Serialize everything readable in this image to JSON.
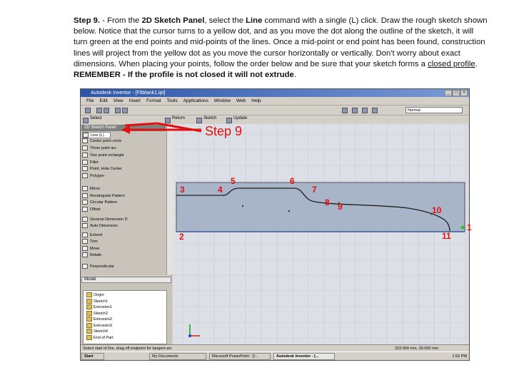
{
  "instructions": {
    "step": "Step 9.",
    "dash": " - From the ",
    "panel": "2D Sketch Panel",
    "p1": ", select the ",
    "cmd": "Line",
    "p2": " command with a single (L) click. Draw the rough sketch shown below. Notice that the cursor turns to a yellow dot, and as you move the dot along the outline of the sketch, it will turn green at the end points and mid-points of the lines. Once a  mid-point or end point has been found, construction lines will project from the yellow dot as you move the cursor horizontally or vertically. Don't worry about exact dimensions. When placing your points, follow the order below and be sure that your sketch forms a ",
    "closed": "closed profile",
    "p3": ". ",
    "remember": "REMEMBER - If the profile is not closed it will not extrude",
    "p4": "."
  },
  "window": {
    "title": "Autodesk Inventor - [Fltblank1.ipt]",
    "menu": [
      "File",
      "Edit",
      "View",
      "Insert",
      "Format",
      "Tools",
      "Applications",
      "Window",
      "Web",
      "Help"
    ],
    "toolbar_labels": [
      "Select",
      "Return",
      "Sketch",
      "Update"
    ],
    "style_combo": "Normal"
  },
  "sketch_panel": {
    "title": "2D Sketch Panel",
    "items": [
      "Line  (L)",
      "Center point circle",
      "Three point arc",
      "Two point rectangle",
      "Fillet",
      "Point, Hole Center",
      "Polygon",
      "Mirror",
      "Rectangular Pattern",
      "Circular Pattern",
      "Offset",
      "General Dimension   D",
      "Auto Dimension",
      "Extend",
      "Trim",
      "Move",
      "Rotate",
      "Perpendicular"
    ]
  },
  "browser": {
    "header": "Model",
    "items": [
      "Origin",
      "Sketch1",
      "Extrusion1",
      "Sketch2",
      "Extrusion2",
      "Extrusion3",
      "Sketch4",
      "End of Part"
    ]
  },
  "status": {
    "left": "Select start of line, drag off endpoint for tangent arc",
    "right": "223.000 mm, 39.000 mm"
  },
  "taskbar": {
    "start": "Start",
    "tasks": [
      "My Documents",
      "Microsoft PowerPoint - [I...",
      "Autodesk Inventor - [..."
    ],
    "clock": "1:52 PM"
  },
  "annotations": {
    "step_label": "Step 9",
    "points": [
      "1",
      "2",
      "3",
      "4",
      "5",
      "6",
      "7",
      "8",
      "9",
      "10",
      "11"
    ]
  },
  "colors": {
    "accent": "#e01010",
    "titlebar": "#2b55a8",
    "sketch_band": "#a8b4c8"
  }
}
